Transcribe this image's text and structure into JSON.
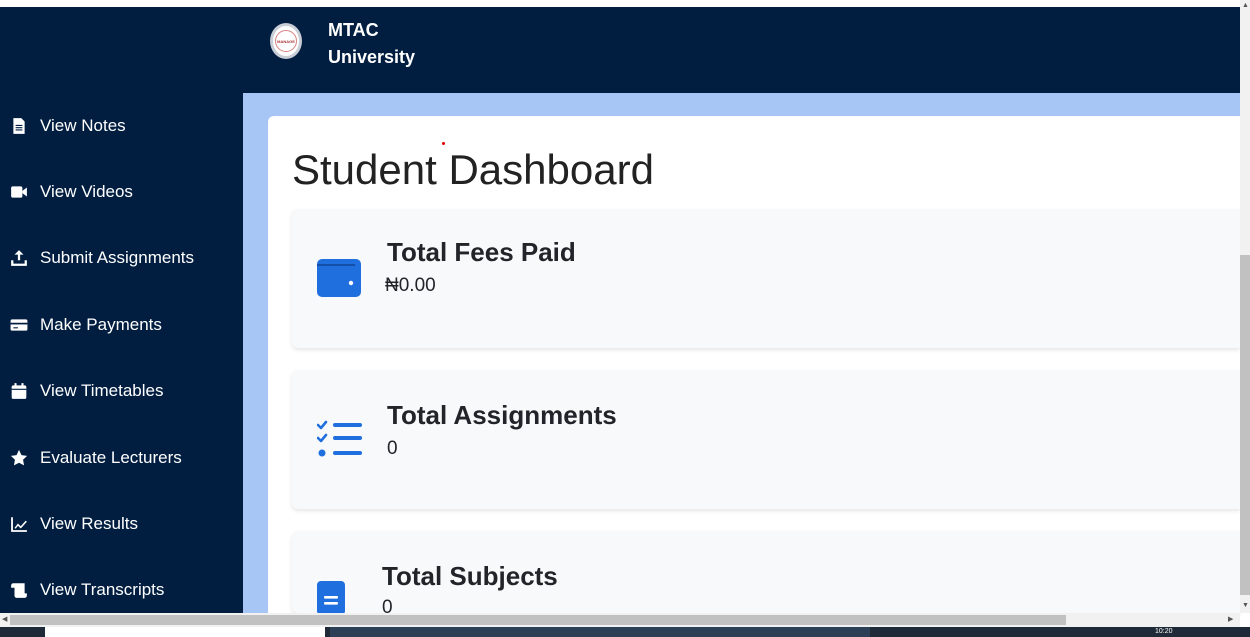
{
  "brand": {
    "line1": "MTAC",
    "line2": "University",
    "logo_text": "MANAGE"
  },
  "sidebar": {
    "items": [
      {
        "label": "View Notes",
        "icon": "file-icon"
      },
      {
        "label": "View Videos",
        "icon": "video-icon"
      },
      {
        "label": "Submit Assignments",
        "icon": "upload-icon"
      },
      {
        "label": "Make Payments",
        "icon": "credit-card-icon"
      },
      {
        "label": "View Timetables",
        "icon": "calendar-icon"
      },
      {
        "label": "Evaluate Lecturers",
        "icon": "star-icon"
      },
      {
        "label": "View Results",
        "icon": "chart-line-icon"
      },
      {
        "label": "View Transcripts",
        "icon": "scroll-icon"
      }
    ]
  },
  "main": {
    "title": "Student Dashboard",
    "cards": [
      {
        "title": "Total Fees Paid",
        "value": "₦0.00",
        "icon": "wallet-icon"
      },
      {
        "title": "Total Assignments",
        "value": "0",
        "icon": "list-check-icon"
      },
      {
        "title": "Total Subjects",
        "value": "0",
        "icon": "book-icon"
      }
    ]
  },
  "system": {
    "clock": "10:20"
  },
  "colors": {
    "navy": "#011e41",
    "content_bg": "#a8c6f5",
    "accent_blue": "#1f6fde"
  }
}
